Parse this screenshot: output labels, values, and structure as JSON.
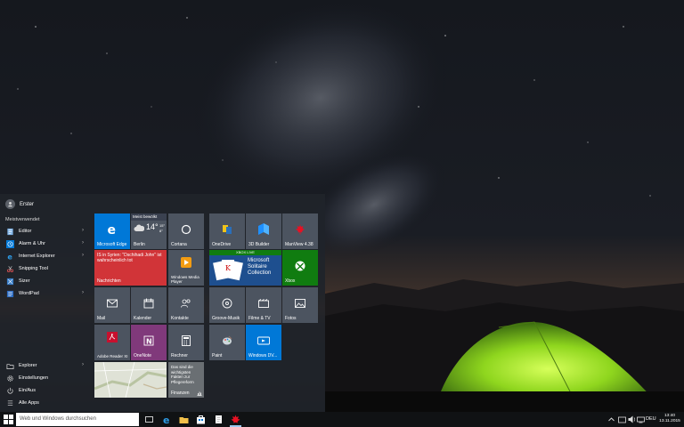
{
  "start_menu": {
    "user_name": "Erster",
    "most_used_heading": "Meistverwendet",
    "apps": [
      {
        "label": "Editor",
        "has_arrow": true
      },
      {
        "label": "Alarm & Uhr",
        "has_arrow": true
      },
      {
        "label": "Internet Explorer",
        "has_arrow": true
      },
      {
        "label": "Snipping Tool",
        "has_arrow": false
      },
      {
        "label": "Sizer",
        "has_arrow": false
      },
      {
        "label": "WordPad",
        "has_arrow": true
      }
    ],
    "bottom": [
      {
        "label": "Explorer",
        "has_arrow": true
      },
      {
        "label": "Einstellungen",
        "has_arrow": false
      },
      {
        "label": "Ein/Aus",
        "has_arrow": false
      },
      {
        "label": "Alle Apps",
        "has_arrow": false
      }
    ]
  },
  "tiles": {
    "edge": "Microsoft Edge",
    "weather_header": "Meist bewölkt",
    "weather_temp": "14°",
    "weather_high": "15°",
    "weather_low": "8°",
    "weather_city": "Berlin",
    "cortana": "Cortana",
    "news_text": "IS in Syrien: \"Dschihadi John\" ist wahrscheinlich tot",
    "news_label": "Nachrichten",
    "wmp": "Windows Media Player",
    "mail": "Mail",
    "calendar": "Kalender",
    "contacts": "Kontakte",
    "adobe": "Adobe Reader XI",
    "onenote": "OneNote",
    "calculator": "Rechner",
    "finance_text": "Das sind die wichtigsten Fakten zur Pflegereform",
    "finance_label": "Finanzen",
    "onedrive": "OneDrive",
    "builder": "3D Builder",
    "maniview": "ManView 4.38",
    "xbox_live": "XBOX LIVE",
    "solitaire": "Microsoft Solitaire Collection",
    "xbox": "Xbox",
    "groove": "Groove-Musik",
    "films": "Filme & TV",
    "photos": "Fotos",
    "paint": "Paint",
    "dvd": "Windows DV..."
  },
  "taskbar": {
    "search_placeholder": "Web und Windows durchsuchen",
    "time": "13:40",
    "date": "13.11.2015",
    "language": "DEU"
  },
  "colors": {
    "accent": "#0078d7",
    "tile_gray": "#4c5460",
    "news_red": "#d13438",
    "xbox_green": "#107c10",
    "onenote_purple": "#80397b"
  }
}
